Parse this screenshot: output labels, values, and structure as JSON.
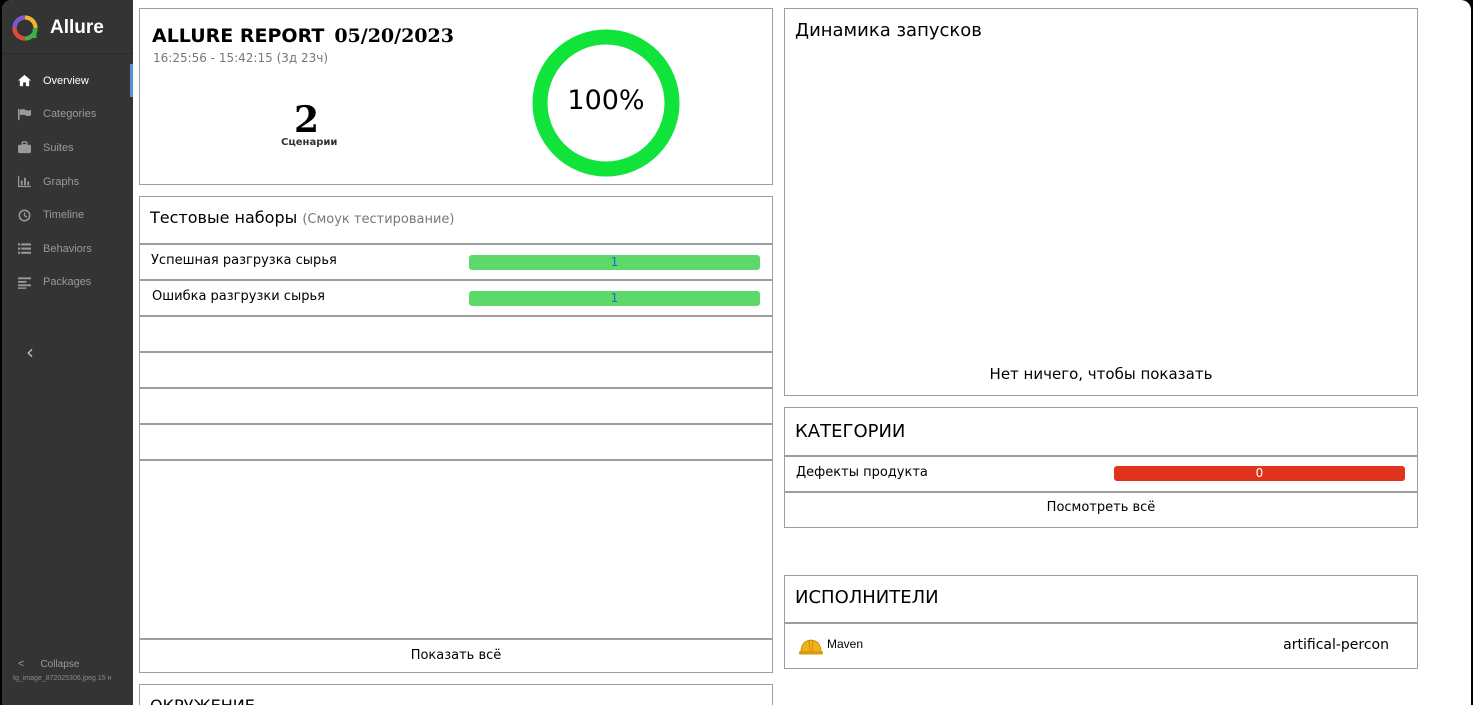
{
  "app": {
    "name": "Allure",
    "accent_color": "#5d8fd7",
    "logo_icon": "allure-logo-icon"
  },
  "sidebar": {
    "items": [
      {
        "label": "Overview",
        "icon": "home-icon",
        "active": true
      },
      {
        "label": "Categories",
        "icon": "flag-icon",
        "active": false
      },
      {
        "label": "Suites",
        "icon": "briefcase-icon",
        "active": false
      },
      {
        "label": "Graphs",
        "icon": "bar-chart-icon",
        "active": false
      },
      {
        "label": "Timeline",
        "icon": "clock-icon",
        "active": false
      },
      {
        "label": "Behaviors",
        "icon": "list-icon",
        "active": false
      },
      {
        "label": "Packages",
        "icon": "align-left-icon",
        "active": false
      }
    ],
    "expand_glyph": "‹",
    "collapse_label": "Collapse",
    "collapse_glyph": "<",
    "file_name": "tg_image_872025306.jpeg 15 н"
  },
  "summary": {
    "title": "ALLURE REPORT",
    "date": "05/20/2023",
    "time_range": "16:25:56 - 15:42:15 (3д 23ч)",
    "count": "2",
    "count_label": "Сценарии",
    "percent_label": "100%",
    "pass_rate": 1.0,
    "ring_color": "#10e33a"
  },
  "suites": {
    "title": "Тестовые наборы",
    "subtitle": "(Смоук тестирование)",
    "rows": [
      {
        "label": "Успешная разгрузка сырья",
        "value": "1"
      },
      {
        "label": "Ошибка разгрузки сырья",
        "value": "1"
      }
    ],
    "show_all": "Показать всё"
  },
  "environment": {
    "title": "ОКРУЖЕНИЕ"
  },
  "trend": {
    "title": "Динамика запусков",
    "empty_text": "Нет ничего, чтобы показать"
  },
  "categories": {
    "title": "КАТЕГОРИИ",
    "rows": [
      {
        "label": "Дефекты продукта",
        "value": "0"
      }
    ],
    "show_all": "Посмотреть всё"
  },
  "executors": {
    "title": "ИСПОЛНИТЕЛИ",
    "rows": [
      {
        "name": "Maven",
        "icon": "maven-hardhat-icon",
        "build": "artifical-percon"
      }
    ]
  }
}
